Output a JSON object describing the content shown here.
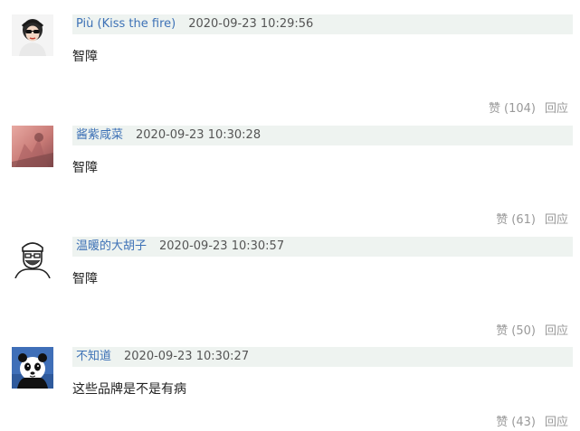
{
  "comments": [
    {
      "username": "Più (Kiss the fire)",
      "timestamp": "2020-09-23 10:29:56",
      "text": "智障",
      "like_label": "赞",
      "like_count": "(104)",
      "reply_label": "回应",
      "avatar_icon": "woman-sunglasses-avatar"
    },
    {
      "username": "酱紫咸菜",
      "timestamp": "2020-09-23 10:30:28",
      "text": "智障",
      "like_label": "赞",
      "like_count": "(61)",
      "reply_label": "回应",
      "avatar_icon": "pink-silhouette-avatar"
    },
    {
      "username": "温暖的大胡子",
      "timestamp": "2020-09-23 10:30:57",
      "text": "智障",
      "like_label": "赞",
      "like_count": "(50)",
      "reply_label": "回应",
      "avatar_icon": "bearded-man-sketch-avatar"
    },
    {
      "username": "不知道",
      "timestamp": "2020-09-23 10:30:27",
      "text": "这些品牌是不是有病",
      "like_label": "赞",
      "like_count": "(43)",
      "reply_label": "回应",
      "avatar_icon": "panda-avatar"
    }
  ],
  "colors": {
    "username": "#3e72b6",
    "meta_background": "#eef3f0",
    "action_text": "#999999"
  }
}
